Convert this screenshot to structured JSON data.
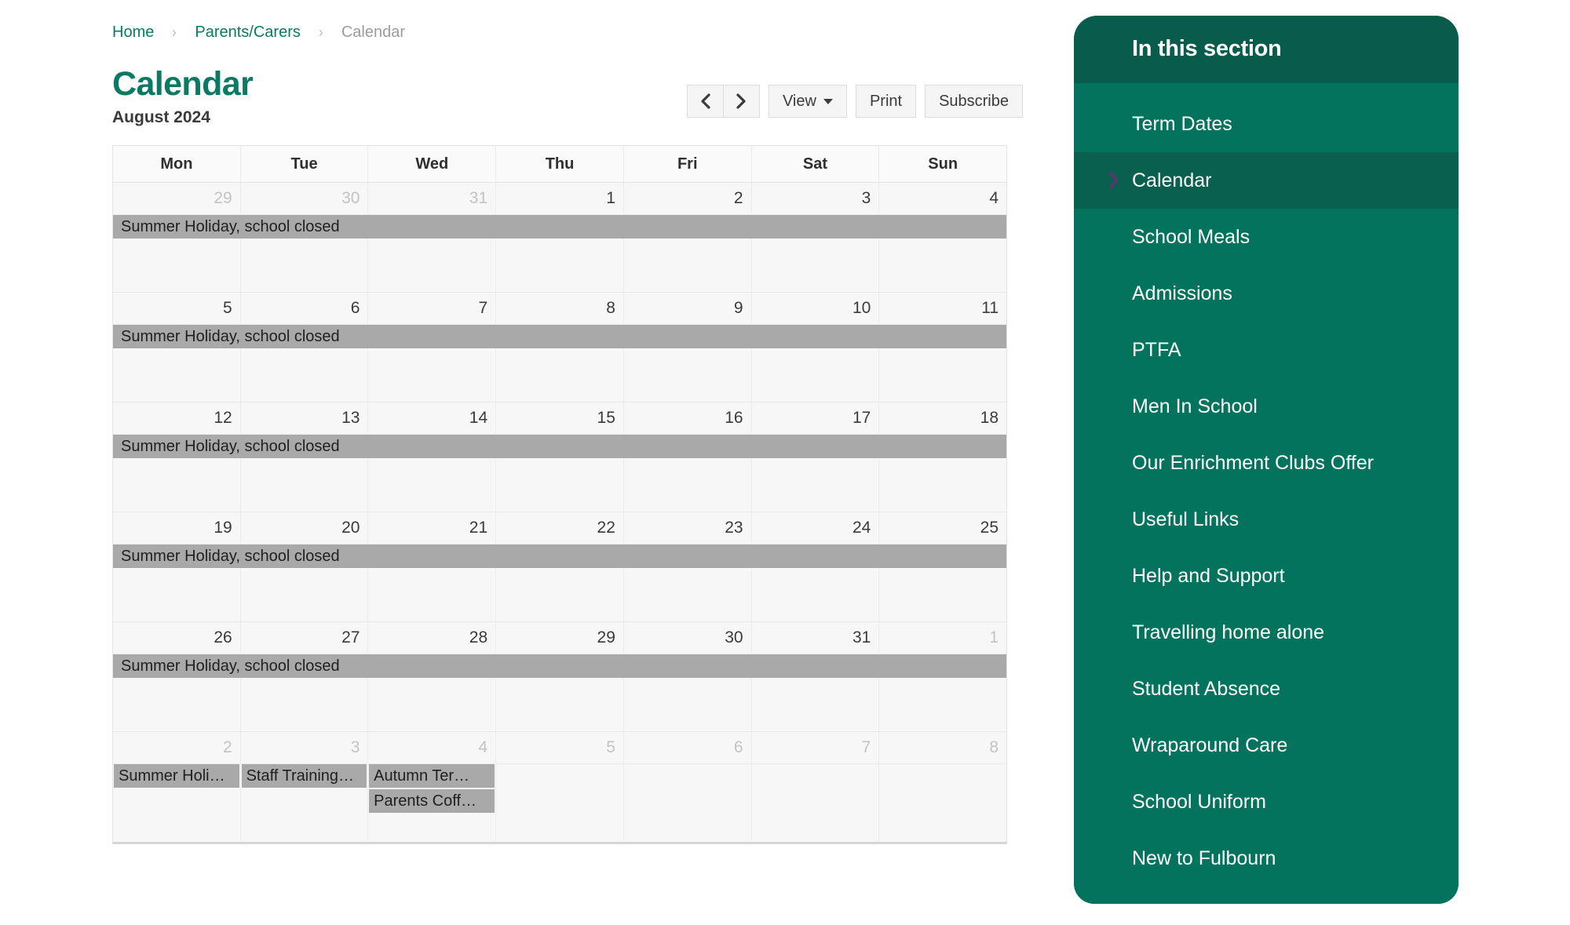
{
  "breadcrumb": {
    "items": [
      {
        "label": "Home",
        "current": false
      },
      {
        "label": "Parents/Carers",
        "current": false
      },
      {
        "label": "Calendar",
        "current": true
      }
    ],
    "separator": "›"
  },
  "page": {
    "title": "Calendar",
    "subtitle": "August 2024"
  },
  "toolbar": {
    "prev_label": "‹",
    "next_label": "›",
    "view_label": "View",
    "print_label": "Print",
    "subscribe_label": "Subscribe"
  },
  "calendar": {
    "month": "August 2024",
    "day_headers": [
      "Mon",
      "Tue",
      "Wed",
      "Thu",
      "Fri",
      "Sat",
      "Sun"
    ],
    "weeks": [
      {
        "days": [
          {
            "n": "29",
            "muted": true
          },
          {
            "n": "30",
            "muted": true
          },
          {
            "n": "31",
            "muted": true
          },
          {
            "n": "1",
            "muted": false
          },
          {
            "n": "2",
            "muted": false
          },
          {
            "n": "3",
            "muted": false
          },
          {
            "n": "4",
            "muted": false
          }
        ],
        "bands": [
          {
            "label": "Summer Holiday, school closed"
          }
        ],
        "chips": []
      },
      {
        "days": [
          {
            "n": "5",
            "muted": false
          },
          {
            "n": "6",
            "muted": false
          },
          {
            "n": "7",
            "muted": false
          },
          {
            "n": "8",
            "muted": false
          },
          {
            "n": "9",
            "muted": false
          },
          {
            "n": "10",
            "muted": false
          },
          {
            "n": "11",
            "muted": false
          }
        ],
        "bands": [
          {
            "label": "Summer Holiday, school closed"
          }
        ],
        "chips": []
      },
      {
        "days": [
          {
            "n": "12",
            "muted": false
          },
          {
            "n": "13",
            "muted": false
          },
          {
            "n": "14",
            "muted": false
          },
          {
            "n": "15",
            "muted": false
          },
          {
            "n": "16",
            "muted": false
          },
          {
            "n": "17",
            "muted": false
          },
          {
            "n": "18",
            "muted": false
          }
        ],
        "bands": [
          {
            "label": "Summer Holiday, school closed"
          }
        ],
        "chips": []
      },
      {
        "days": [
          {
            "n": "19",
            "muted": false
          },
          {
            "n": "20",
            "muted": false
          },
          {
            "n": "21",
            "muted": false
          },
          {
            "n": "22",
            "muted": false
          },
          {
            "n": "23",
            "muted": false
          },
          {
            "n": "24",
            "muted": false
          },
          {
            "n": "25",
            "muted": false
          }
        ],
        "bands": [
          {
            "label": "Summer Holiday, school closed"
          }
        ],
        "chips": []
      },
      {
        "days": [
          {
            "n": "26",
            "muted": false
          },
          {
            "n": "27",
            "muted": false
          },
          {
            "n": "28",
            "muted": false
          },
          {
            "n": "29",
            "muted": false
          },
          {
            "n": "30",
            "muted": false
          },
          {
            "n": "31",
            "muted": false
          },
          {
            "n": "1",
            "muted": true
          }
        ],
        "bands": [
          {
            "label": "Summer Holiday, school closed"
          }
        ],
        "chips": []
      },
      {
        "days": [
          {
            "n": "2",
            "muted": true
          },
          {
            "n": "3",
            "muted": true
          },
          {
            "n": "4",
            "muted": true
          },
          {
            "n": "5",
            "muted": true
          },
          {
            "n": "6",
            "muted": true
          },
          {
            "n": "7",
            "muted": true
          },
          {
            "n": "8",
            "muted": true
          }
        ],
        "bands": [],
        "chips": [
          {
            "label": "Summer Holi…",
            "col": 0,
            "row": 0
          },
          {
            "label": "Staff Training…",
            "col": 1,
            "row": 0
          },
          {
            "label": "Autumn Ter…",
            "col": 2,
            "row": 0
          },
          {
            "label": "Parents Coff…",
            "col": 2,
            "row": 1
          }
        ]
      }
    ]
  },
  "sidebar": {
    "heading": "In this section",
    "items": [
      {
        "label": "Term Dates",
        "active": false
      },
      {
        "label": "Calendar",
        "active": true
      },
      {
        "label": "School Meals",
        "active": false
      },
      {
        "label": "Admissions",
        "active": false
      },
      {
        "label": "PTFA",
        "active": false
      },
      {
        "label": "Men In School",
        "active": false
      },
      {
        "label": "Our Enrichment Clubs Offer",
        "active": false
      },
      {
        "label": "Useful Links",
        "active": false
      },
      {
        "label": "Help and Support",
        "active": false
      },
      {
        "label": "Travelling home alone",
        "active": false
      },
      {
        "label": "Student Absence",
        "active": false
      },
      {
        "label": "Wraparound Care",
        "active": false
      },
      {
        "label": "School Uniform",
        "active": false
      },
      {
        "label": "New to Fulbourn",
        "active": false
      }
    ]
  },
  "colors": {
    "brand_green": "#0b7a63",
    "sidebar_body": "#03735e",
    "sidebar_header": "#075c4c",
    "sidebar_active": "#09604f",
    "chevron_purple": "#6b2d7a",
    "event_gray": "#a9a9a9",
    "cell_bg": "#f7f7f7"
  }
}
